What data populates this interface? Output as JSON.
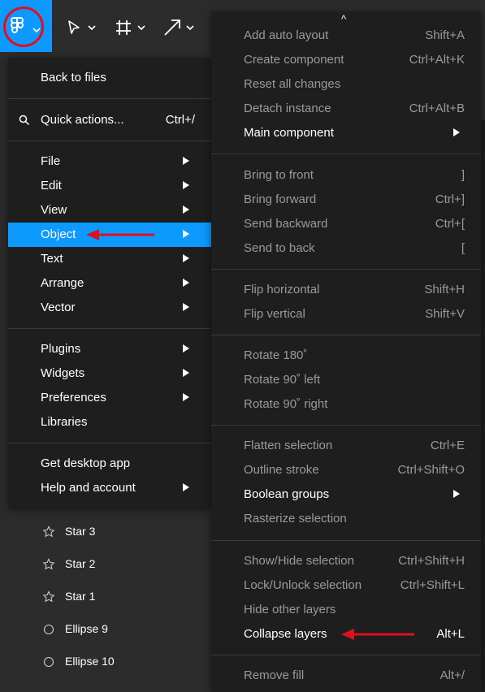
{
  "toolbar": {
    "tools": [
      {
        "icon": "figma-logo-icon"
      },
      {
        "icon": "move-cursor-icon"
      },
      {
        "icon": "frame-icon"
      },
      {
        "icon": "arrow-icon"
      }
    ],
    "accent_color": "#0d99ff",
    "highlight_color": "#e0101e"
  },
  "main_menu": {
    "back": "Back to files",
    "quick_actions": {
      "label": "Quick actions...",
      "shortcut": "Ctrl+/"
    },
    "group1": [
      "File",
      "Edit",
      "View",
      "Object",
      "Text",
      "Arrange",
      "Vector"
    ],
    "group2": [
      "Plugins",
      "Widgets",
      "Preferences",
      "Libraries"
    ],
    "group3": [
      "Get desktop app",
      "Help and account"
    ],
    "active_item": "Object"
  },
  "sub_menu": {
    "caret": "^",
    "items": [
      {
        "label": "Add auto layout",
        "shortcut": "Shift+A",
        "enabled": false
      },
      {
        "label": "Create component",
        "shortcut": "Ctrl+Alt+K",
        "enabled": false
      },
      {
        "label": "Reset all changes",
        "shortcut": "",
        "enabled": false
      },
      {
        "label": "Detach instance",
        "shortcut": "Ctrl+Alt+B",
        "enabled": false
      },
      {
        "label": "Main component",
        "shortcut": "",
        "enabled": true,
        "submenu": true
      },
      {
        "label": "Bring to front",
        "shortcut": "]",
        "enabled": false
      },
      {
        "label": "Bring forward",
        "shortcut": "Ctrl+]",
        "enabled": false
      },
      {
        "label": "Send backward",
        "shortcut": "Ctrl+[",
        "enabled": false
      },
      {
        "label": "Send to back",
        "shortcut": "[",
        "enabled": false
      },
      {
        "label": "Flip horizontal",
        "shortcut": "Shift+H",
        "enabled": false
      },
      {
        "label": "Flip vertical",
        "shortcut": "Shift+V",
        "enabled": false
      },
      {
        "label": "Rotate 180˚",
        "shortcut": "",
        "enabled": false
      },
      {
        "label": "Rotate 90˚ left",
        "shortcut": "",
        "enabled": false
      },
      {
        "label": "Rotate 90˚ right",
        "shortcut": "",
        "enabled": false
      },
      {
        "label": "Flatten selection",
        "shortcut": "Ctrl+E",
        "enabled": false
      },
      {
        "label": "Outline stroke",
        "shortcut": "Ctrl+Shift+O",
        "enabled": false
      },
      {
        "label": "Boolean groups",
        "shortcut": "",
        "enabled": true,
        "submenu": true
      },
      {
        "label": "Rasterize selection",
        "shortcut": "",
        "enabled": false
      },
      {
        "label": "Show/Hide selection",
        "shortcut": "Ctrl+Shift+H",
        "enabled": false
      },
      {
        "label": "Lock/Unlock selection",
        "shortcut": "Ctrl+Shift+L",
        "enabled": false
      },
      {
        "label": "Hide other layers",
        "shortcut": "",
        "enabled": false
      },
      {
        "label": "Collapse layers",
        "shortcut": "Alt+L",
        "enabled": true
      },
      {
        "label": "Remove fill",
        "shortcut": "Alt+/",
        "enabled": false
      }
    ]
  },
  "layers": [
    {
      "label": "Star 3",
      "icon": "star-icon"
    },
    {
      "label": "Star 2",
      "icon": "star-icon"
    },
    {
      "label": "Star 1",
      "icon": "star-icon"
    },
    {
      "label": "Ellipse 9",
      "icon": "ellipse-icon"
    },
    {
      "label": "Ellipse 10",
      "icon": "ellipse-icon"
    }
  ]
}
